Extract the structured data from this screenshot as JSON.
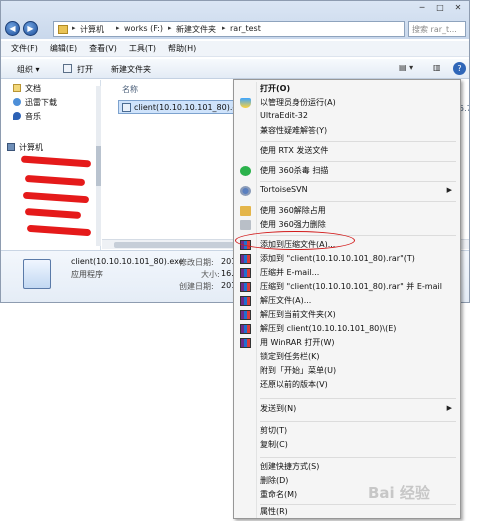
{
  "address_bar": {
    "crumbs": [
      "计算机",
      "works (F:)",
      "新建文件夹",
      "rar_test"
    ],
    "search_placeholder": "搜索 rar_t...",
    "back_icon": "back-arrow-icon",
    "forward_icon": "forward-arrow-icon"
  },
  "menu_bar": [
    "文件(F)",
    "编辑(E)",
    "查看(V)",
    "工具(T)",
    "帮助(H)"
  ],
  "toolbar": {
    "organize": "组织 ▾",
    "open": "打开",
    "new_folder": "新建文件夹"
  },
  "nav_pane": {
    "items": [
      "文档",
      "迅雷下载",
      "音乐"
    ],
    "computer": "计算机"
  },
  "file_list": {
    "column_name": "名称",
    "column_clip": "5.76",
    "file_name": "client(10.10.10.101_80).exe"
  },
  "details": {
    "title": "client(10.10.10.101_80).exe",
    "subtitle": "应用程序",
    "modified_label": "修改日期:",
    "modified_value": "201",
    "size_label": "大小:",
    "size_value": "16.",
    "created_label": "创建日期:",
    "created_value": "201"
  },
  "context_menu": {
    "open": "打开(O)",
    "run_as_admin": "以管理员身份运行(A)",
    "ultraedit": "UltraEdit-32",
    "compat": "兼容性疑难解答(Y)",
    "rtx": "使用 RTX 发送文件",
    "scan360": "使用 360杀毒 扫描",
    "tortoise": "TortoiseSVN",
    "unlock360": "使用 360解除占用",
    "delete360": "使用 360强力删除",
    "add_archive": "添加到压缩文件(A)...",
    "add_to_rar": "添加到 \"client(10.10.10.101_80).rar\"(T)",
    "compress_email": "压缩并 E-mail...",
    "compress_rar_email": "压缩到 \"client(10.10.10.101_80).rar\" 并 E-mail",
    "extract_files": "解压文件(A)...",
    "extract_here": "解压到当前文件夹(X)",
    "extract_to": "解压到 client(10.10.10.101_80)\\(E)",
    "open_winrar": "用 WinRAR 打开(W)",
    "pin_taskbar": "锁定到任务栏(K)",
    "pin_start": "附到「开始」菜单(U)",
    "restore": "还原以前的版本(V)",
    "send_to": "发送到(N)",
    "cut": "剪切(T)",
    "copy": "复制(C)",
    "create_shortcut": "创建快捷方式(S)",
    "delete": "删除(D)",
    "rename": "重命名(M)",
    "properties": "属性(R)"
  },
  "watermark": "Bai 经验",
  "colors": {
    "highlight_ring": "#d21a1a",
    "redaction": "#e51a1a"
  }
}
